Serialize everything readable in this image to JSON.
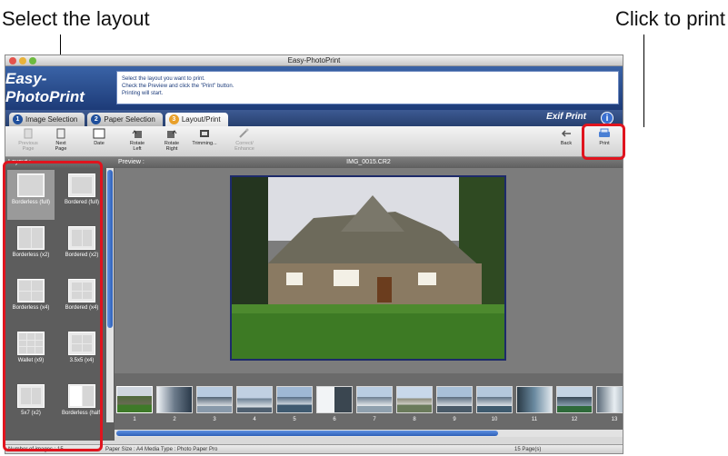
{
  "callouts": {
    "select_layout": "Select the layout",
    "click_to_print": "Click to print"
  },
  "window": {
    "title": "Easy-PhotoPrint",
    "logo": "Easy-PhotoPrint",
    "instructions": [
      "Select the layout you want to print.",
      "Check the Preview and click the \"Print\" button.",
      "Printing will start."
    ]
  },
  "tabs": [
    {
      "num": "1",
      "label": "Image Selection"
    },
    {
      "num": "2",
      "label": "Paper Selection"
    },
    {
      "num": "3",
      "label": "Layout/Print"
    }
  ],
  "exif_print": "Exif Print",
  "toolbar": {
    "previous_page": [
      "Previous",
      "Page"
    ],
    "next_page": [
      "Next",
      "Page"
    ],
    "date": "Date",
    "rotate_left": [
      "Rotate",
      "Left"
    ],
    "rotate_right": [
      "Rotate",
      "Right"
    ],
    "trimming": "Trimming...",
    "correct_enhance": [
      "Correct/",
      "Enhance"
    ],
    "back": "Back",
    "print": "Print"
  },
  "panels": {
    "layout_label": "Layout :",
    "preview_label": "Preview :",
    "filename": "IMG_0015.CR2"
  },
  "layouts": [
    {
      "name": "Borderless (full)",
      "selected": true
    },
    {
      "name": "Bordered (full)"
    },
    {
      "name": "Borderless (x2)"
    },
    {
      "name": "Bordered (x2)"
    },
    {
      "name": "Borderless (x4)"
    },
    {
      "name": "Bordered (x4)"
    },
    {
      "name": "Wallet (x9)"
    },
    {
      "name": "3.5x5 (x4)"
    },
    {
      "name": "5x7 (x2)"
    },
    {
      "name": "Borderless (half)"
    }
  ],
  "filmstrip": [
    "1",
    "2",
    "3",
    "4",
    "5",
    "6",
    "7",
    "8",
    "9",
    "10",
    "11",
    "12",
    "13"
  ],
  "status": {
    "number_of_images": "Number of images : 15",
    "paper_info": "Paper Size : A4 Media Type : Photo Paper Pro",
    "pages": "15 Page(s)"
  }
}
